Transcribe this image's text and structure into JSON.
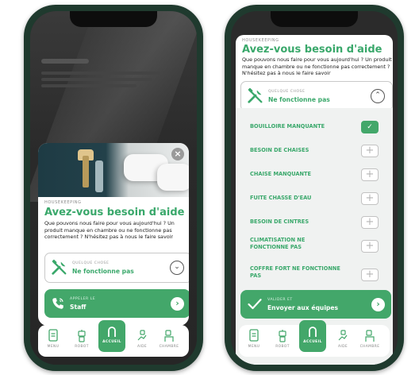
{
  "left_screen": {
    "kicker": "HOUSEKEEPING",
    "title": "Avez-vous besoin d'aide",
    "description": "Que pouvons nous faire pour vous aujourd'hui ? Un produit manque en chambre ou ne fonctionne pas correctement ? N'hésitez pas à nous le faire savoir",
    "select": {
      "label": "QUELQUE CHOSE",
      "value": "Ne fonctionne pas"
    },
    "call_button": {
      "label": "APPELER LE",
      "value": "Staff"
    }
  },
  "right_screen": {
    "kicker": "HOUSEKEEPING",
    "title": "Avez-vous besoin d'aide",
    "description": "Que pouvons nous faire pour vous aujourd'hui ? Un produit manque en chambre ou ne fonctionne pas correctement ? N'hésitez pas à nous le faire savoir",
    "select": {
      "label": "QUELQUE CHOSE",
      "value": "Ne fonctionne pas"
    },
    "items": [
      {
        "label": "BOUILLOIRE MANQUANTE",
        "checked": true
      },
      {
        "label": "BESOIN DE CHAISES",
        "checked": false
      },
      {
        "label": "CHAISE MANQUANTE",
        "checked": false
      },
      {
        "label": "FUITE CHASSE D'EAU",
        "checked": false
      },
      {
        "label": "BESOIN DE CINTRES",
        "checked": false
      },
      {
        "label": "CLIMATISATION NE FONCTIONNE PAS",
        "checked": false
      },
      {
        "label": "COFFRE FORT NE FONCTIONNE PAS",
        "checked": false
      }
    ],
    "submit_button": {
      "label": "VALIDER ET",
      "value": "Envoyer aux équipes"
    }
  },
  "nav": {
    "items": [
      {
        "label": "MENU",
        "icon": "menu-icon"
      },
      {
        "label": "ROBOT",
        "icon": "robot-icon"
      },
      {
        "label": "ACCUEIL",
        "icon": "home-icon",
        "active": true
      },
      {
        "label": "AIDE",
        "icon": "help-icon"
      },
      {
        "label": "CHAMBRE",
        "icon": "bed-icon"
      }
    ]
  },
  "colors": {
    "accent": "#43a76a",
    "phone_frame": "#1f3a2e",
    "text": "#1a1a1a"
  }
}
